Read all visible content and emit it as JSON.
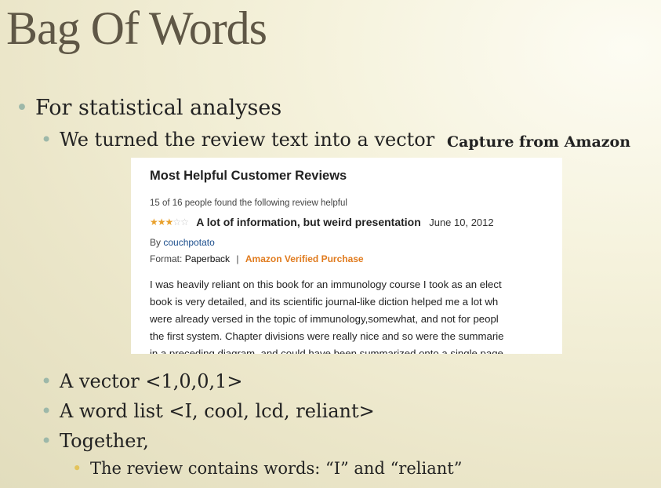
{
  "slide": {
    "title": "Bag Of Words",
    "bullets": {
      "level1": "For statistical analyses",
      "sub1": "We turned the review text into a vector",
      "sub2": "A vector <1,0,0,1>",
      "sub3": "A word list <I, cool, lcd, reliant>",
      "sub4": "Together,",
      "sub4_child": "The review contains words: “I” and “reliant”"
    },
    "caption": "Capture from Amazon",
    "bullet_marker": "•"
  },
  "amazon_review": {
    "section_heading": "Most Helpful Customer Reviews",
    "helpful_count_text": "15 of 16 people found the following review helpful",
    "rating": 3,
    "rating_max": 5,
    "star_filled": "★",
    "star_empty": "☆",
    "title": "A lot of information, but weird presentation",
    "date": "June 10, 2012",
    "by_label": "By",
    "author": "couchpotato",
    "format_label": "Format:",
    "format_value": "Paperback",
    "separator": "|",
    "verified_label": "Amazon Verified Purchase",
    "body_lines": [
      "I was heavily reliant on this book for an immunology course I took as an elect",
      "book is very detailed, and its scientific journal-like diction helped me a lot wh",
      "were already versed in the topic of immunology,somewhat, and not for peopl",
      "the first system. Chapter divisions were really nice and so were the summarie",
      "in a preceding diagram, and could have been summarized onto a single page"
    ],
    "colors": {
      "star": "#e8a02c",
      "verified": "#e07b1e",
      "author_link": "#1a4d8c"
    }
  },
  "theme": {
    "title_color": "#5f5746",
    "bullet_color": "#9db8a9",
    "sub_bullet_color": "#e3c35b"
  }
}
